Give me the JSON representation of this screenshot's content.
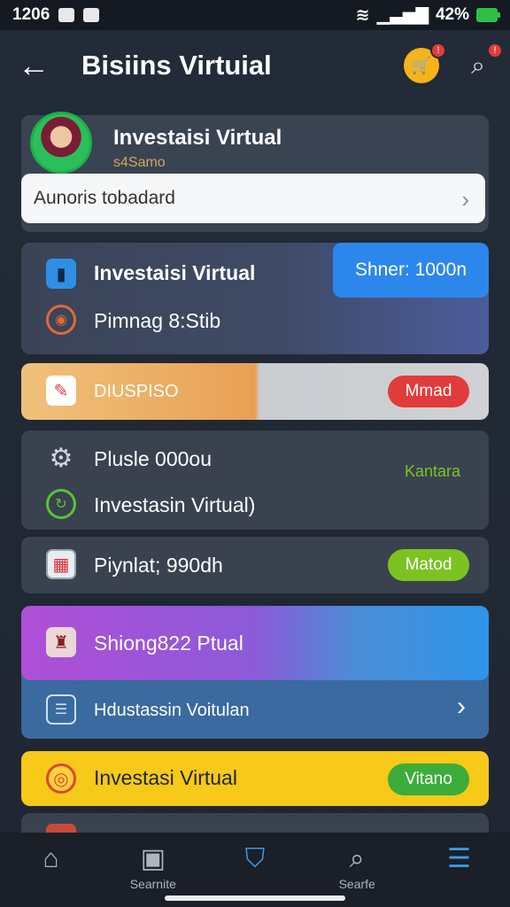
{
  "status_bar": {
    "time": "1206",
    "battery": "42%"
  },
  "header": {
    "back_glyph": "←",
    "title": "Bisiins Virtuial"
  },
  "card_profile": {
    "title": "Investaisi Virtual",
    "subtitle": "s4Samo",
    "row_label": "Aunoris tobadard"
  },
  "card_investment": {
    "title": "Investaisi Virtual",
    "row2": "Pimnag 8:Stib",
    "pill": "Shner: 1000n"
  },
  "card_discount": {
    "label": "DIUSPISO",
    "pill": "Mmad"
  },
  "card_settings": {
    "title": "Plusle 000ou",
    "subtitle": "Investasin Virtual)",
    "right_label": "Kantara"
  },
  "card_payment": {
    "label": "Piynlat; 990dh",
    "pill": "Matod"
  },
  "card_shop": {
    "title": "Shiong822 Ptual",
    "sub": "Hdustassin Voitulan"
  },
  "card_yellow": {
    "label": "Investasi Virtual",
    "pill": "Vitano"
  },
  "bottom_nav": {
    "item2": "Searnite",
    "item4": "Searfe"
  },
  "colors": {
    "accent_blue": "#2c87ec",
    "pill_red": "#e23b3b",
    "pill_green": "#7cc321",
    "yellow": "#f7c918"
  }
}
